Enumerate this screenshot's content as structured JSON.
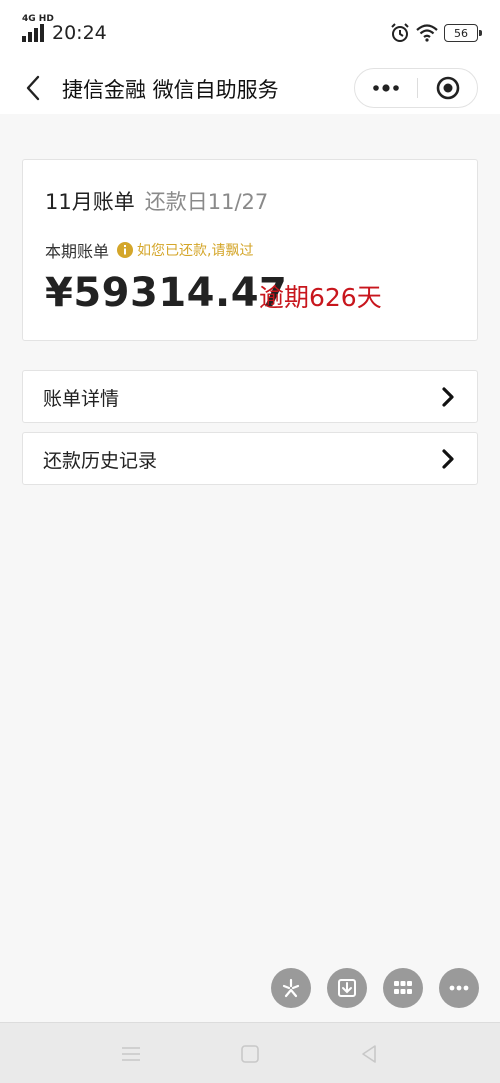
{
  "status_bar": {
    "network": "4G HD",
    "time": "20:24",
    "battery": "56",
    "icons": [
      "signal-icon",
      "alarm-icon",
      "wifi-icon",
      "battery-icon"
    ]
  },
  "title_bar": {
    "title": "捷信金融 微信自助服务",
    "back_icon": "back-arrow-icon",
    "more_icon": "more-dots-icon",
    "close_icon": "close-target-icon"
  },
  "bill": {
    "month_label": "11月账单",
    "due_label": "还款日11/27",
    "period_label": "本期账单",
    "notice": "如您已还款,请飘过",
    "amount": "¥59314.47",
    "overdue": "逾期626天"
  },
  "menu": {
    "items": [
      {
        "label": "账单详情",
        "icon": "chevron-right-icon"
      },
      {
        "label": "还款历史记录",
        "icon": "chevron-right-icon"
      }
    ]
  },
  "floating_buttons": [
    "sparkle-icon",
    "download-icon",
    "grid-icon",
    "more-icon"
  ],
  "nav_bar": [
    "menu-icon",
    "home-square-icon",
    "back-triangle-icon"
  ],
  "colors": {
    "overdue": "#c8161d",
    "notice": "#d4a62a",
    "background": "#f7f7f7",
    "fab": "#9a9a9a"
  }
}
